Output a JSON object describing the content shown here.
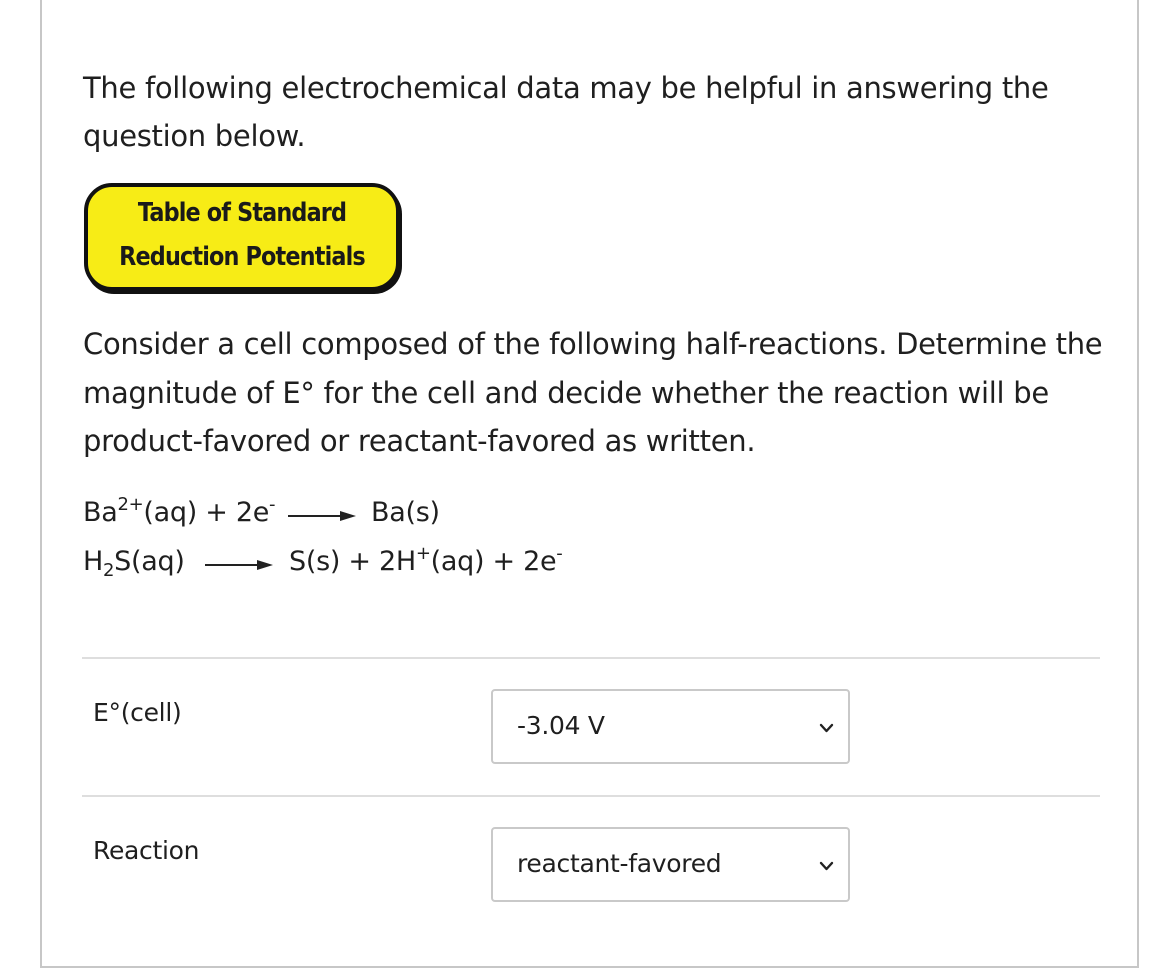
{
  "intro": {
    "text": "The following electrochemical data may be helpful in answering the question below."
  },
  "badge": {
    "line1": "Table of Standard",
    "line2": "Reduction Potentials"
  },
  "question": {
    "text": "Consider a cell composed of the following half-reactions. Determine the magnitude of E° for the cell and decide whether the reaction will be product-favored or reactant-favored as written."
  },
  "half_reactions": [
    {
      "reactant_species": "Ba",
      "reactant_charge": "2+",
      "reactant_rest": "(aq) + 2e",
      "reactant_electron_sup": "-",
      "product": "Ba(s)"
    },
    {
      "reactant_pre": "H",
      "reactant_sub": "2",
      "reactant_post": "S(aq)",
      "product_pre": "S(s) + 2H",
      "product_sup": "+",
      "product_mid": "(aq) + 2e",
      "product_electron_sup": "-"
    }
  ],
  "fields": [
    {
      "label": "E°(cell)",
      "selected": "-3.04 V",
      "icon": "chevron-down-icon"
    },
    {
      "label": "Reaction",
      "selected": "reactant-favored",
      "icon": "chevron-down-icon"
    }
  ],
  "colors": {
    "badge_fill": "#f7ec16",
    "badge_border": "#111111",
    "panel_border": "#c7c7c7",
    "divider": "#dedede",
    "select_border": "#c9c9c9"
  }
}
